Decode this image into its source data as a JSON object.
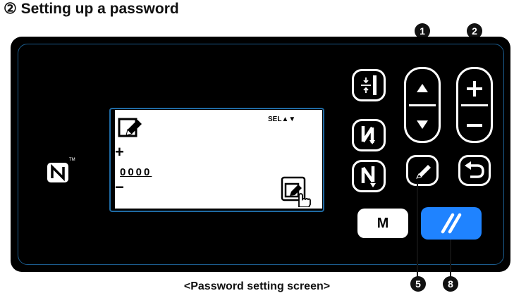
{
  "title": "② Setting up a password",
  "callouts": {
    "up_down": "1",
    "plus_minus": "2",
    "edit": "5",
    "reset": "8"
  },
  "screen": {
    "sel": "SEL▲▼",
    "plus_sign": "+",
    "value": "0000",
    "minus_sign": "−"
  },
  "buttons": {
    "m_label": "M"
  },
  "caption": "<Password setting screen>",
  "colors": {
    "panel": "#000000",
    "accent_blue": "#1f83ff",
    "border_blue": "#1f6aa3"
  },
  "icons": [
    "nfc-icon",
    "password-edit-icon",
    "hand-pointer-icon",
    "thread-trim-icon",
    "reverse-stitch-icon",
    "normal-stitch-icon",
    "up-arrow-icon",
    "down-arrow-icon",
    "plus-icon",
    "minus-icon",
    "pencil-icon",
    "return-icon",
    "reset-icon"
  ]
}
